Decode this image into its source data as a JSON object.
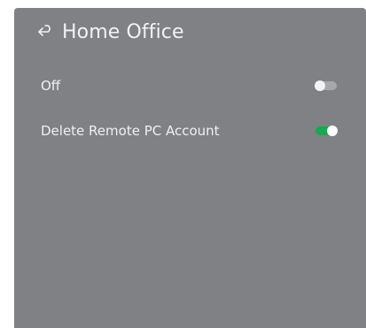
{
  "header": {
    "back_icon": "back-arrow-icon",
    "title": "Home Office"
  },
  "settings": [
    {
      "label": "Off",
      "toggle_state": "off"
    },
    {
      "label": "Delete Remote PC Account",
      "toggle_state": "on"
    }
  ],
  "colors": {
    "panel_background": "#808184",
    "toggle_on": "#18a84f",
    "toggle_off": "#a7a8aa",
    "text": "#f0f0f0"
  }
}
